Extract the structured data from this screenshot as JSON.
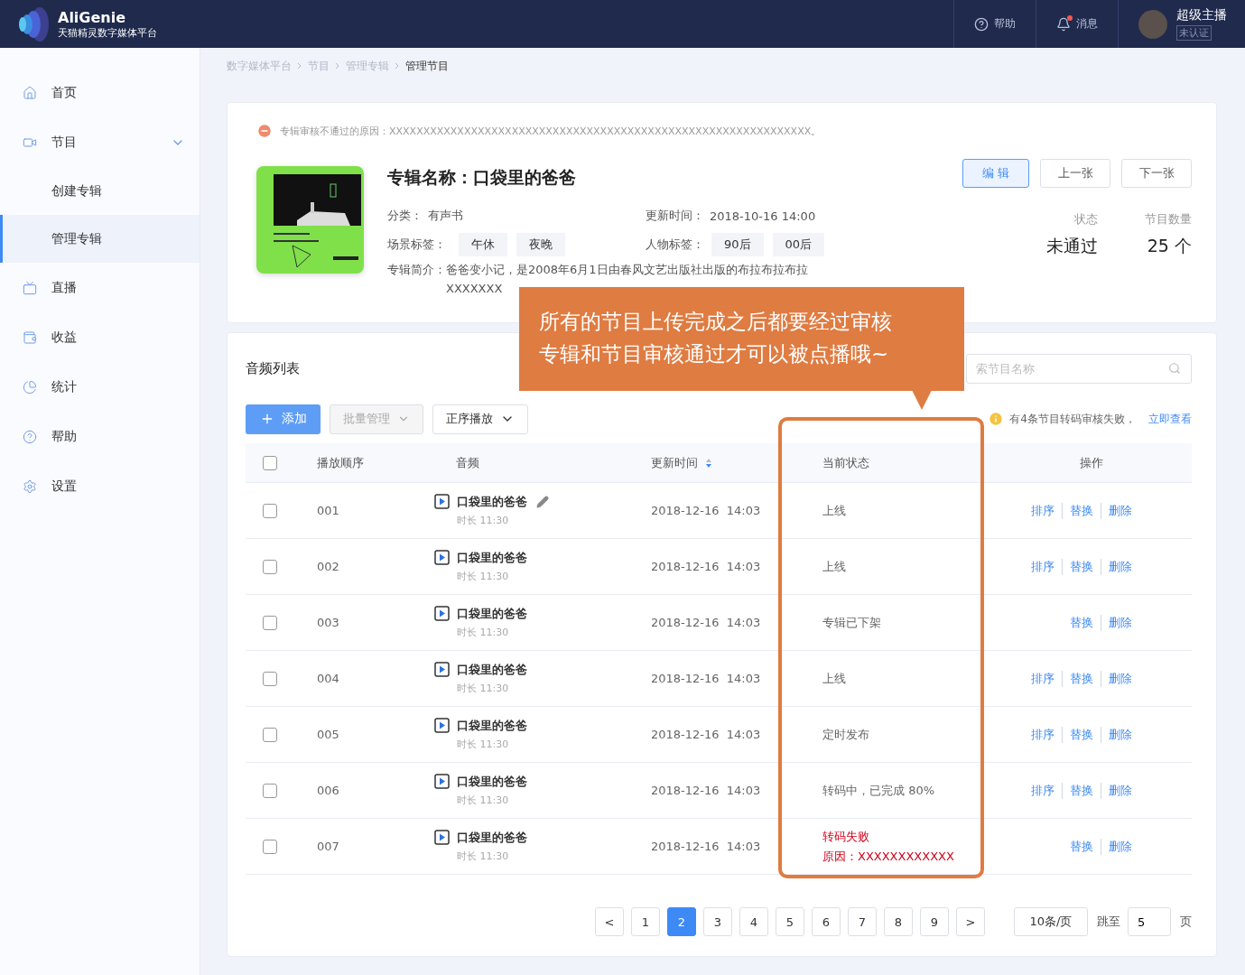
{
  "header": {
    "brand": "AliGenie",
    "subtitle": "天猫精灵数字媒体平台",
    "help": "帮助",
    "messages": "消息",
    "has_unread": true,
    "user": "超级主播",
    "user_badge": "未认证"
  },
  "sidebar": {
    "items": [
      {
        "label": "首页",
        "selected": false
      },
      {
        "label": "节目",
        "selected": false,
        "expanded": true,
        "children": [
          {
            "label": "创建专辑",
            "selected": false
          },
          {
            "label": "管理专辑",
            "selected": true
          }
        ]
      },
      {
        "label": "直播",
        "selected": false
      },
      {
        "label": "收益",
        "selected": false
      },
      {
        "label": "统计",
        "selected": false
      },
      {
        "label": "帮助",
        "selected": false
      },
      {
        "label": "设置",
        "selected": false
      }
    ]
  },
  "breadcrumb": [
    "数字媒体平台",
    "节目",
    "管理专辑",
    "管理节目"
  ],
  "album": {
    "reject_reason": "专辑审核不通过的原因：XXXXXXXXXXXXXXXXXXXXXXXXXXXXXXXXXXXXXXXXXXXXXXXXXXXXXXXXXXXXXX。",
    "title_label": "专辑名称：",
    "title": "口袋里的爸爸",
    "category_label": "分类：",
    "category": "有声书",
    "updated_label": "更新时间：",
    "updated": "2018-10-16  14:00",
    "scene_label": "场景标签：",
    "scene_tags": [
      "午休",
      "夜晚"
    ],
    "people_label": "人物标签：",
    "people_tags": [
      "90后",
      "00后"
    ],
    "intro_label": "专辑简介：",
    "intro_lines": [
      "爸爸变小记，是2008年6月1日由春风文艺出版社出版的布拉布拉布拉",
      "XXXXXXX"
    ],
    "buttons": [
      {
        "label": "编 辑",
        "primary": true
      },
      {
        "label": "上一张",
        "primary": false
      },
      {
        "label": "下一张",
        "primary": false
      }
    ],
    "stats": [
      {
        "label": "状态",
        "value": "未通过"
      },
      {
        "label": "节目数量",
        "value": "25 个"
      }
    ]
  },
  "list": {
    "title": "音频列表",
    "search_placeholder": "索节目名称",
    "add": "添加",
    "batch": "批量管理",
    "batch_disabled": true,
    "order": "正序播放",
    "notice": "有4条节目转码审核失败，",
    "notice_link": "立即查看",
    "select_all_checked": false,
    "columns": [
      "播放顺序",
      "音频",
      "更新时间",
      "当前状态",
      "操作"
    ],
    "rows": [
      {
        "checked": false,
        "order": "001",
        "title": "口袋里的爸爸",
        "editable": true,
        "duration": "时长 11:30",
        "time": "2018-12-16  14:03",
        "status": [
          "上线"
        ],
        "failed": false,
        "actions": [
          "排序",
          "替换",
          "删除"
        ]
      },
      {
        "checked": false,
        "order": "002",
        "title": "口袋里的爸爸",
        "editable": false,
        "duration": "时长 11:30",
        "time": "2018-12-16  14:03",
        "status": [
          "上线"
        ],
        "failed": false,
        "actions": [
          "排序",
          "替换",
          "删除"
        ]
      },
      {
        "checked": false,
        "order": "003",
        "title": "口袋里的爸爸",
        "editable": false,
        "duration": "时长 11:30",
        "time": "2018-12-16  14:03",
        "status": [
          "专辑已下架"
        ],
        "failed": false,
        "actions": [
          "替换",
          "删除"
        ]
      },
      {
        "checked": false,
        "order": "004",
        "title": "口袋里的爸爸",
        "editable": false,
        "duration": "时长 11:30",
        "time": "2018-12-16  14:03",
        "status": [
          "上线"
        ],
        "failed": false,
        "actions": [
          "排序",
          "替换",
          "删除"
        ]
      },
      {
        "checked": false,
        "order": "005",
        "title": "口袋里的爸爸",
        "editable": false,
        "duration": "时长 11:30",
        "time": "2018-12-16  14:03",
        "status": [
          "定时发布"
        ],
        "failed": false,
        "actions": [
          "排序",
          "替换",
          "删除"
        ]
      },
      {
        "checked": false,
        "order": "006",
        "title": "口袋里的爸爸",
        "editable": false,
        "duration": "时长 11:30",
        "time": "2018-12-16  14:03",
        "status": [
          "转码中，已完成 80%"
        ],
        "failed": false,
        "actions": [
          "排序",
          "替换",
          "删除"
        ]
      },
      {
        "checked": false,
        "order": "007",
        "title": "口袋里的爸爸",
        "editable": false,
        "duration": "时长 11:30",
        "time": "2018-12-16  14:03",
        "status": [
          "转码失败",
          "原因：XXXXXXXXXXXX"
        ],
        "failed": true,
        "actions": [
          "替换",
          "删除"
        ]
      }
    ],
    "pagination": {
      "prev": "<",
      "next": ">",
      "pages": [
        {
          "label": "1",
          "selected": false
        },
        {
          "label": "2",
          "selected": true
        },
        {
          "label": "3",
          "selected": false
        },
        {
          "label": "4",
          "selected": false
        },
        {
          "label": "5",
          "selected": false
        },
        {
          "label": "6",
          "selected": false
        },
        {
          "label": "7",
          "selected": false
        },
        {
          "label": "8",
          "selected": false
        },
        {
          "label": "9",
          "selected": false
        }
      ],
      "page_size": "10条/页",
      "jump_label": "跳至",
      "jump_value": "5",
      "page_unit": "页"
    }
  },
  "callout": {
    "lines": [
      "所有的节目上传完成之后都要经过审核",
      "专辑和节目审核通过才可以被点播哦~"
    ]
  }
}
